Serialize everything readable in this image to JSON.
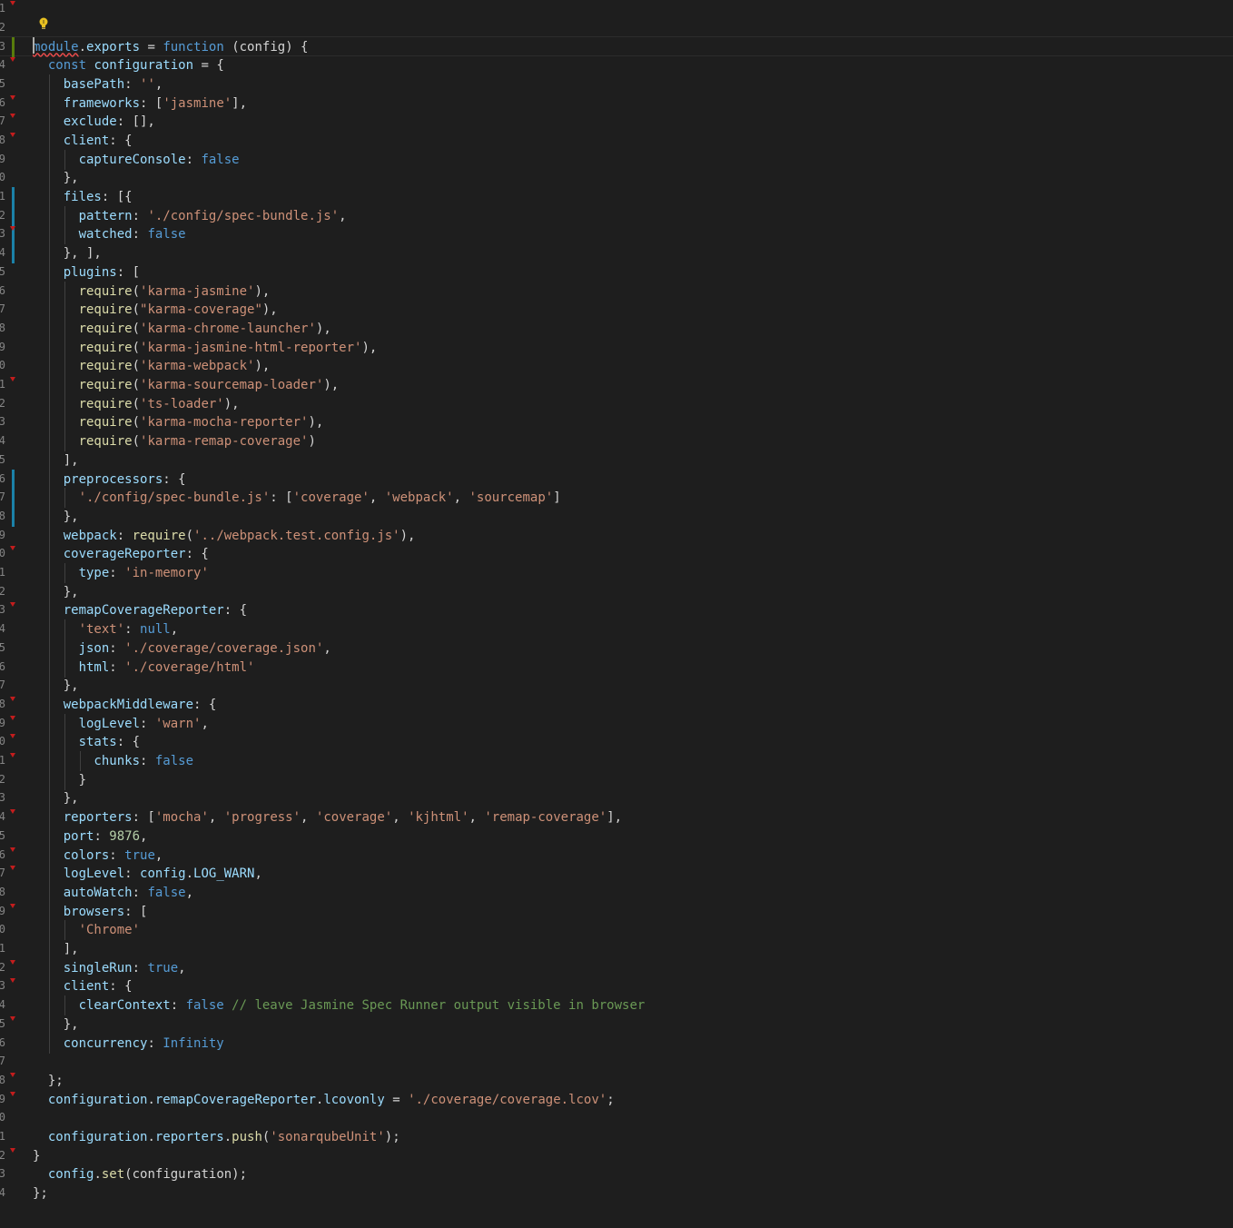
{
  "editor": {
    "line_numbers": [
      "1",
      "2",
      "3",
      "4",
      "5",
      "6",
      "7",
      "8",
      "9",
      "0",
      "1",
      "2",
      "3",
      "4",
      "5",
      "6",
      "7",
      "8",
      "9",
      "0",
      "1",
      "2",
      "3",
      "4",
      "5",
      "6",
      "7",
      "8",
      "9",
      "0",
      "1",
      "2",
      "3",
      "4",
      "5",
      "6",
      "7",
      "8",
      "9",
      "0",
      "1",
      "2",
      "3",
      "4",
      "5",
      "6",
      "7",
      "8",
      "9",
      "0",
      "1",
      "2",
      "3",
      "4",
      "5",
      "6",
      "7",
      "8",
      "9",
      "0",
      "1",
      "2",
      "3",
      "4"
    ],
    "lightbulb_icon": "lightbulb-icon",
    "colors": {
      "background": "#1e1e1e",
      "keyword": "#569cd6",
      "string": "#ce9178",
      "property": "#9cdcfe",
      "function": "#dcdcaa",
      "number": "#b5cea8",
      "comment": "#6a9955",
      "gutter_modified": "#1b81a8",
      "gutter_added": "#587c0c"
    },
    "lines": [
      [],
      [],
      [
        [
          "kw",
          "module"
        ],
        [
          "pl",
          "."
        ],
        [
          "prop",
          "exports"
        ],
        [
          "pl",
          " = "
        ],
        [
          "kw",
          "function"
        ],
        [
          "pl",
          " (config) {"
        ]
      ],
      [
        [
          "kw",
          "  const"
        ],
        [
          "prop",
          " configuration"
        ],
        [
          "pl",
          " = {"
        ]
      ],
      [
        [
          "prop",
          "    basePath"
        ],
        [
          "pl",
          ": "
        ],
        [
          "str",
          "''"
        ],
        [
          "pl",
          ","
        ]
      ],
      [
        [
          "prop",
          "    frameworks"
        ],
        [
          "pl",
          ": ["
        ],
        [
          "str",
          "'jasmine'"
        ],
        [
          "pl",
          "],"
        ]
      ],
      [
        [
          "prop",
          "    exclude"
        ],
        [
          "pl",
          ": [],"
        ]
      ],
      [
        [
          "prop",
          "    client"
        ],
        [
          "pl",
          ": {"
        ]
      ],
      [
        [
          "prop",
          "      captureConsole"
        ],
        [
          "pl",
          ": "
        ],
        [
          "kw",
          "false"
        ]
      ],
      [
        [
          "pl",
          "    },"
        ]
      ],
      [
        [
          "prop",
          "    files"
        ],
        [
          "pl",
          ": [{"
        ]
      ],
      [
        [
          "prop",
          "      pattern"
        ],
        [
          "pl",
          ": "
        ],
        [
          "str",
          "'./config/spec-bundle.js'"
        ],
        [
          "pl",
          ","
        ]
      ],
      [
        [
          "prop",
          "      watched"
        ],
        [
          "pl",
          ": "
        ],
        [
          "kw",
          "false"
        ]
      ],
      [
        [
          "pl",
          "    }, ],"
        ]
      ],
      [
        [
          "prop",
          "    plugins"
        ],
        [
          "pl",
          ": ["
        ]
      ],
      [
        [
          "fn",
          "      require"
        ],
        [
          "pl",
          "("
        ],
        [
          "str",
          "'karma-jasmine'"
        ],
        [
          "pl",
          "),"
        ]
      ],
      [
        [
          "fn",
          "      require"
        ],
        [
          "pl",
          "("
        ],
        [
          "str",
          "\"karma-coverage\""
        ],
        [
          "pl",
          "),"
        ]
      ],
      [
        [
          "fn",
          "      require"
        ],
        [
          "pl",
          "("
        ],
        [
          "str",
          "'karma-chrome-launcher'"
        ],
        [
          "pl",
          "),"
        ]
      ],
      [
        [
          "fn",
          "      require"
        ],
        [
          "pl",
          "("
        ],
        [
          "str",
          "'karma-jasmine-html-reporter'"
        ],
        [
          "pl",
          "),"
        ]
      ],
      [
        [
          "fn",
          "      require"
        ],
        [
          "pl",
          "("
        ],
        [
          "str",
          "'karma-webpack'"
        ],
        [
          "pl",
          "),"
        ]
      ],
      [
        [
          "fn",
          "      require"
        ],
        [
          "pl",
          "("
        ],
        [
          "str",
          "'karma-sourcemap-loader'"
        ],
        [
          "pl",
          "),"
        ]
      ],
      [
        [
          "fn",
          "      require"
        ],
        [
          "pl",
          "("
        ],
        [
          "str",
          "'ts-loader'"
        ],
        [
          "pl",
          "),"
        ]
      ],
      [
        [
          "fn",
          "      require"
        ],
        [
          "pl",
          "("
        ],
        [
          "str",
          "'karma-mocha-reporter'"
        ],
        [
          "pl",
          "),"
        ]
      ],
      [
        [
          "fn",
          "      require"
        ],
        [
          "pl",
          "("
        ],
        [
          "str",
          "'karma-remap-coverage'"
        ],
        [
          "pl",
          ")"
        ]
      ],
      [
        [
          "pl",
          "    ],"
        ]
      ],
      [
        [
          "prop",
          "    preprocessors"
        ],
        [
          "pl",
          ": {"
        ]
      ],
      [
        [
          "str",
          "      './config/spec-bundle.js'"
        ],
        [
          "pl",
          ": ["
        ],
        [
          "str",
          "'coverage'"
        ],
        [
          "pl",
          ", "
        ],
        [
          "str",
          "'webpack'"
        ],
        [
          "pl",
          ", "
        ],
        [
          "str",
          "'sourcemap'"
        ],
        [
          "pl",
          "]"
        ]
      ],
      [
        [
          "pl",
          "    },"
        ]
      ],
      [
        [
          "prop",
          "    webpack"
        ],
        [
          "pl",
          ": "
        ],
        [
          "fn",
          "require"
        ],
        [
          "pl",
          "("
        ],
        [
          "str",
          "'../webpack.test.config.js'"
        ],
        [
          "pl",
          "),"
        ]
      ],
      [
        [
          "prop",
          "    coverageReporter"
        ],
        [
          "pl",
          ": {"
        ]
      ],
      [
        [
          "prop",
          "      type"
        ],
        [
          "pl",
          ": "
        ],
        [
          "str",
          "'in-memory'"
        ]
      ],
      [
        [
          "pl",
          "    },"
        ]
      ],
      [
        [
          "prop",
          "    remapCoverageReporter"
        ],
        [
          "pl",
          ": {"
        ]
      ],
      [
        [
          "str",
          "      'text'"
        ],
        [
          "pl",
          ": "
        ],
        [
          "kw",
          "null"
        ],
        [
          "pl",
          ","
        ]
      ],
      [
        [
          "prop",
          "      json"
        ],
        [
          "pl",
          ": "
        ],
        [
          "str",
          "'./coverage/coverage.json'"
        ],
        [
          "pl",
          ","
        ]
      ],
      [
        [
          "prop",
          "      html"
        ],
        [
          "pl",
          ": "
        ],
        [
          "str",
          "'./coverage/html'"
        ]
      ],
      [
        [
          "pl",
          "    },"
        ]
      ],
      [
        [
          "prop",
          "    webpackMiddleware"
        ],
        [
          "pl",
          ": {"
        ]
      ],
      [
        [
          "prop",
          "      logLevel"
        ],
        [
          "pl",
          ": "
        ],
        [
          "str",
          "'warn'"
        ],
        [
          "pl",
          ","
        ]
      ],
      [
        [
          "prop",
          "      stats"
        ],
        [
          "pl",
          ": {"
        ]
      ],
      [
        [
          "prop",
          "        chunks"
        ],
        [
          "pl",
          ": "
        ],
        [
          "kw",
          "false"
        ]
      ],
      [
        [
          "pl",
          "      }"
        ]
      ],
      [
        [
          "pl",
          "    },"
        ]
      ],
      [
        [
          "prop",
          "    reporters"
        ],
        [
          "pl",
          ": ["
        ],
        [
          "str",
          "'mocha'"
        ],
        [
          "pl",
          ", "
        ],
        [
          "str",
          "'progress'"
        ],
        [
          "pl",
          ", "
        ],
        [
          "str",
          "'coverage'"
        ],
        [
          "pl",
          ", "
        ],
        [
          "str",
          "'kjhtml'"
        ],
        [
          "pl",
          ", "
        ],
        [
          "str",
          "'remap-coverage'"
        ],
        [
          "pl",
          "],"
        ]
      ],
      [
        [
          "prop",
          "    port"
        ],
        [
          "pl",
          ": "
        ],
        [
          "num",
          "9876"
        ],
        [
          "pl",
          ","
        ]
      ],
      [
        [
          "prop",
          "    colors"
        ],
        [
          "pl",
          ": "
        ],
        [
          "kw",
          "true"
        ],
        [
          "pl",
          ","
        ]
      ],
      [
        [
          "prop",
          "    logLevel"
        ],
        [
          "pl",
          ": "
        ],
        [
          "prop",
          "config"
        ],
        [
          "pl",
          "."
        ],
        [
          "prop",
          "LOG_WARN"
        ],
        [
          "pl",
          ","
        ]
      ],
      [
        [
          "prop",
          "    autoWatch"
        ],
        [
          "pl",
          ": "
        ],
        [
          "kw",
          "false"
        ],
        [
          "pl",
          ","
        ]
      ],
      [
        [
          "prop",
          "    browsers"
        ],
        [
          "pl",
          ": ["
        ]
      ],
      [
        [
          "str",
          "      'Chrome'"
        ]
      ],
      [
        [
          "pl",
          "    ],"
        ]
      ],
      [
        [
          "prop",
          "    singleRun"
        ],
        [
          "pl",
          ": "
        ],
        [
          "kw",
          "true"
        ],
        [
          "pl",
          ","
        ]
      ],
      [
        [
          "prop",
          "    client"
        ],
        [
          "pl",
          ": {"
        ]
      ],
      [
        [
          "prop",
          "      clearContext"
        ],
        [
          "pl",
          ": "
        ],
        [
          "kw",
          "false"
        ],
        [
          "cmt",
          " // leave Jasmine Spec Runner output visible in browser"
        ]
      ],
      [
        [
          "pl",
          "    },"
        ]
      ],
      [
        [
          "prop",
          "    concurrency"
        ],
        [
          "pl",
          ": "
        ],
        [
          "kw",
          "Infinity"
        ]
      ],
      [],
      [
        [
          "pl",
          "  };"
        ]
      ],
      [
        [
          "prop",
          "  configuration"
        ],
        [
          "pl",
          "."
        ],
        [
          "prop",
          "remapCoverageReporter"
        ],
        [
          "pl",
          "."
        ],
        [
          "prop",
          "lcovonly"
        ],
        [
          "pl",
          " = "
        ],
        [
          "str",
          "'./coverage/coverage.lcov'"
        ],
        [
          "pl",
          ";"
        ]
      ],
      [],
      [
        [
          "prop",
          "  configuration"
        ],
        [
          "pl",
          "."
        ],
        [
          "prop",
          "reporters"
        ],
        [
          "pl",
          "."
        ],
        [
          "fn",
          "push"
        ],
        [
          "pl",
          "("
        ],
        [
          "str",
          "'sonarqubeUnit'"
        ],
        [
          "pl",
          ");"
        ]
      ],
      [
        [
          "pl",
          "}"
        ]
      ],
      [
        [
          "prop",
          "  config"
        ],
        [
          "pl",
          "."
        ],
        [
          "fn",
          "set"
        ],
        [
          "pl",
          "(configuration);"
        ]
      ],
      [
        [
          "pl",
          "};"
        ]
      ]
    ]
  }
}
